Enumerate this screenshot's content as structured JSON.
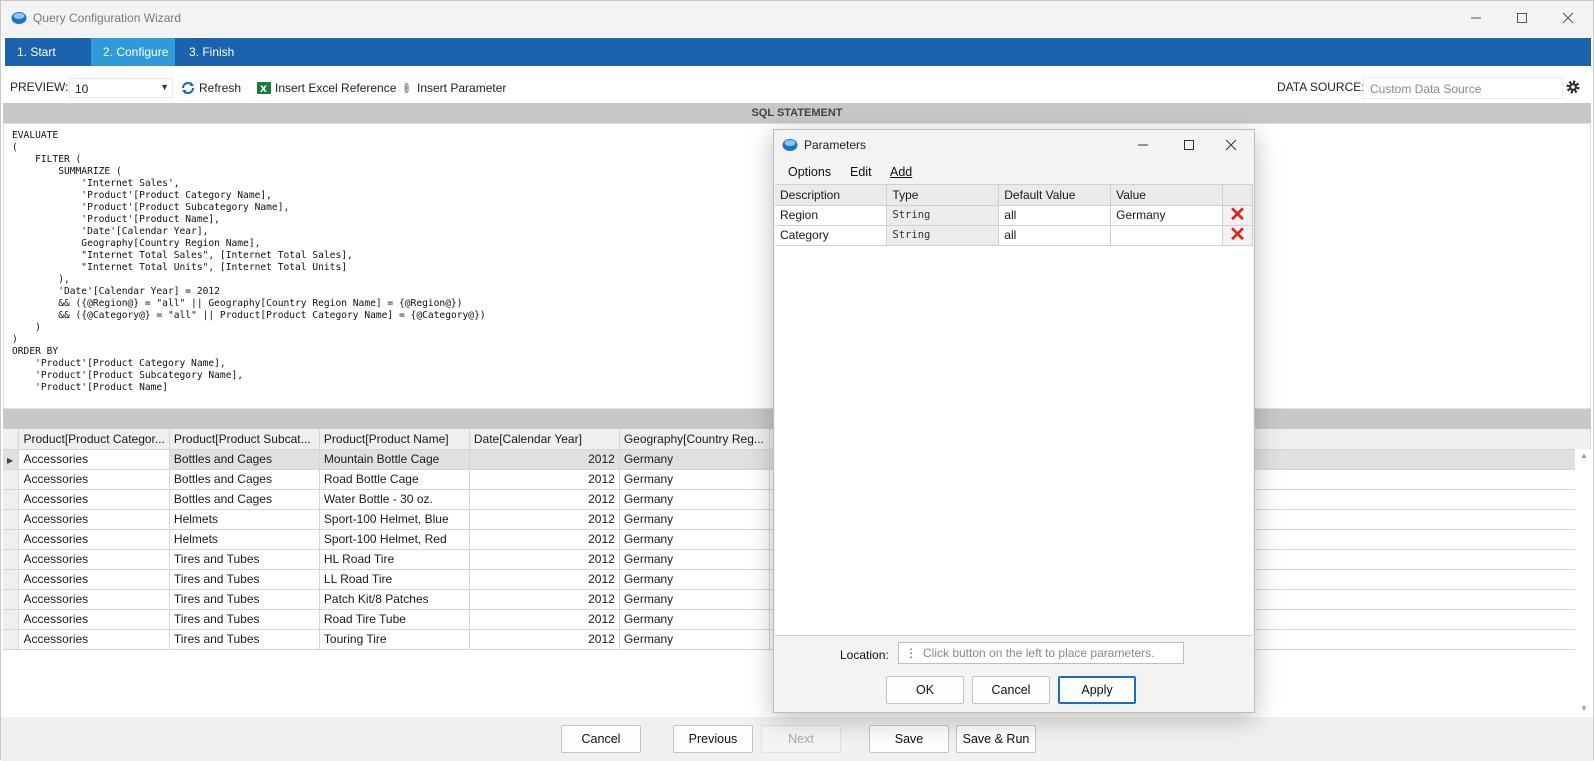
{
  "window": {
    "title": "Query Configuration Wizard"
  },
  "tabs": [
    {
      "label": "1. Start",
      "active": false
    },
    {
      "label": "2. Configure",
      "active": true
    },
    {
      "label": "3. Finish",
      "active": false
    }
  ],
  "toolbar": {
    "preview_label": "PREVIEW:",
    "preview_value": "10",
    "refresh_label": "Refresh",
    "insert_excel_label": "Insert Excel Reference",
    "insert_param_label": "Insert Parameter",
    "datasource_label": "DATA SOURCE:",
    "datasource_placeholder": "Custom Data Source"
  },
  "sql": {
    "header": "SQL STATEMENT",
    "text": "EVALUATE\n(\n    FILTER (\n        SUMMARIZE (\n            'Internet Sales',\n            'Product'[Product Category Name],\n            'Product'[Product Subcategory Name],\n            'Product'[Product Name],\n            'Date'[Calendar Year],\n            Geography[Country Region Name],\n            \"Internet Total Sales\", [Internet Total Sales],\n            \"Internet Total Units\", [Internet Total Units]\n        ),\n        'Date'[Calendar Year] = 2012\n        && ({@Region@} = \"all\" || Geography[Country Region Name] = {@Region@})\n        && ({@Category@} = \"all\" || Product[Product Category Name] = {@Category@})\n    )\n)\nORDER BY\n    'Product'[Product Category Name],\n    'Product'[Product Subcategory Name],\n    'Product'[Product Name]"
  },
  "grid": {
    "columns": [
      "Product[Product Categor...",
      "Product[Product Subcat...",
      "Product[Product Name]",
      "Date[Calendar Year]",
      "Geography[Country Reg..."
    ],
    "rows": [
      [
        "Accessories",
        "Bottles and Cages",
        "Mountain Bottle Cage",
        "2012",
        "Germany"
      ],
      [
        "Accessories",
        "Bottles and Cages",
        "Road Bottle Cage",
        "2012",
        "Germany"
      ],
      [
        "Accessories",
        "Bottles and Cages",
        "Water Bottle - 30 oz.",
        "2012",
        "Germany"
      ],
      [
        "Accessories",
        "Helmets",
        "Sport-100 Helmet, Blue",
        "2012",
        "Germany"
      ],
      [
        "Accessories",
        "Helmets",
        "Sport-100 Helmet, Red",
        "2012",
        "Germany"
      ],
      [
        "Accessories",
        "Tires and Tubes",
        "HL Road Tire",
        "2012",
        "Germany"
      ],
      [
        "Accessories",
        "Tires and Tubes",
        "LL Road Tire",
        "2012",
        "Germany"
      ],
      [
        "Accessories",
        "Tires and Tubes",
        "Patch Kit/8 Patches",
        "2012",
        "Germany"
      ],
      [
        "Accessories",
        "Tires and Tubes",
        "Road Tire Tube",
        "2012",
        "Germany"
      ],
      [
        "Accessories",
        "Tires and Tubes",
        "Touring Tire",
        "2012",
        "Germany"
      ]
    ]
  },
  "footer": {
    "cancel": "Cancel",
    "previous": "Previous",
    "next": "Next",
    "save": "Save",
    "save_run": "Save & Run"
  },
  "params_dialog": {
    "title": "Parameters",
    "menu": [
      "Options",
      "Edit",
      "Add"
    ],
    "columns": [
      "Description",
      "Type",
      "Default Value",
      "Value"
    ],
    "rows": [
      {
        "description": "Region",
        "type": "String",
        "default": "all",
        "value": "Germany"
      },
      {
        "description": "Category",
        "type": "String",
        "default": "all",
        "value": ""
      }
    ],
    "location_label": "Location:",
    "location_placeholder": "Click button on the left to place parameters.",
    "ok": "OK",
    "cancel": "Cancel",
    "apply": "Apply"
  },
  "colors": {
    "tabbar": "#1c63ad",
    "tab_active": "#2f9ad8",
    "delete_icon": "#d9271b"
  }
}
